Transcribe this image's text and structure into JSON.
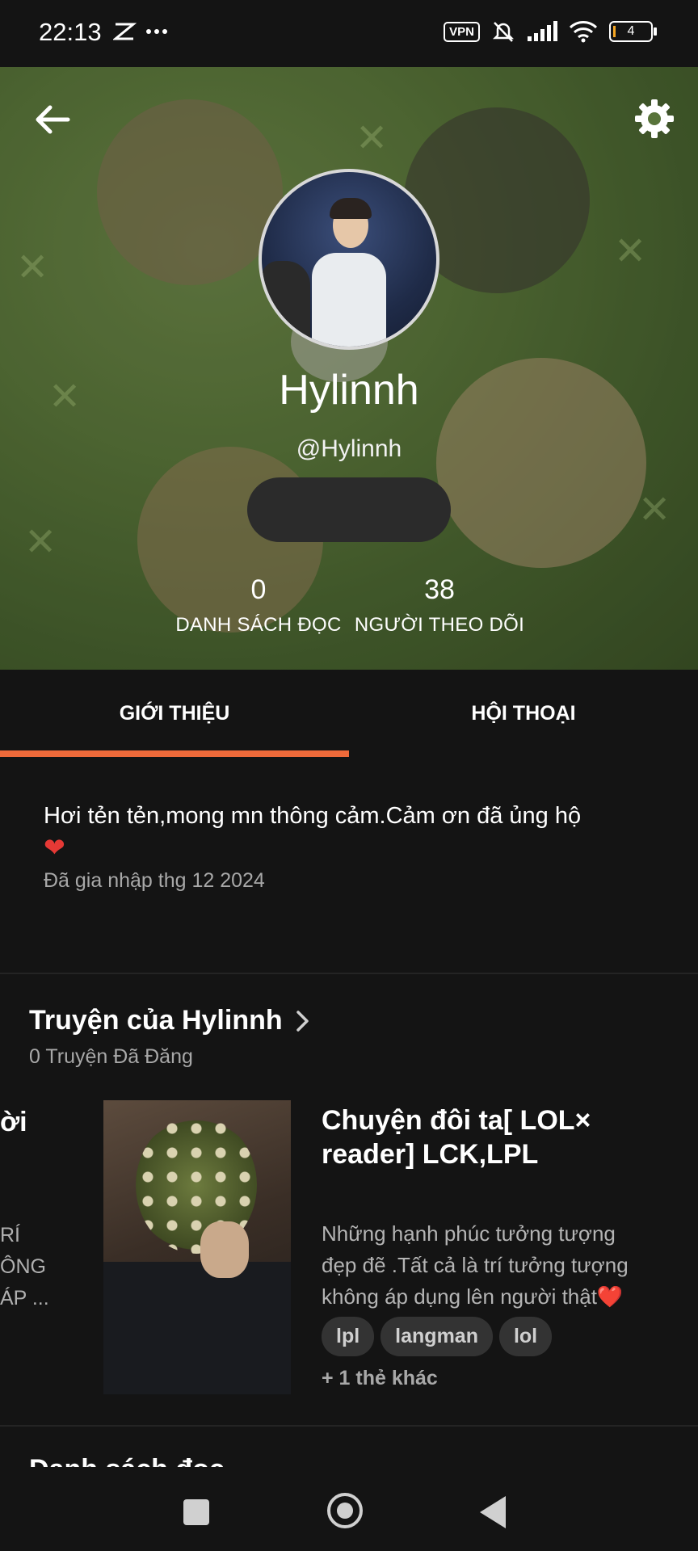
{
  "status_bar": {
    "time": "22:13",
    "icons": [
      "capcut-icon",
      "more-dots-icon"
    ],
    "vpn_label": "VPN",
    "battery_level": "4",
    "right_icons": [
      "vpn-icon",
      "bell-muted-icon",
      "signal-icon",
      "wifi-icon",
      "battery-icon"
    ]
  },
  "profile": {
    "display_name": "Hylinnh",
    "username": "@Hylinnh",
    "stats": {
      "reading_lists_count": "0",
      "reading_lists_label": "DANH SÁCH ĐỌC",
      "followers_count": "38",
      "followers_label": "NGƯỜI THEO DÕI"
    }
  },
  "tabs": [
    {
      "label": "GIỚI THIỆU",
      "active": true
    },
    {
      "label": "HỘI THOẠI",
      "active": false
    }
  ],
  "about": {
    "bio": "Hơi tẻn tẻn,mong mn thông cảm.Cảm ơn đã ủng hộ",
    "bio_emoji": "❤",
    "joined": "Đã gia nhập thg 12 2024"
  },
  "stories": {
    "title": "Truyện của Hylinnh",
    "count_label": "0 Truyện Đã Đăng",
    "prev_card": {
      "title_fragment": "ời",
      "desc_lines": [
        "RÍ",
        "ÔNG",
        "ÁP ..."
      ]
    },
    "items": [
      {
        "title": "Chuyện đôi ta[ LOL× reader] LCK,LPL",
        "description": "Những hạnh phúc tưởng tượng đẹp đẽ .Tất cả là trí tưởng tượng không áp dụng lên người thật❤️",
        "tags": [
          "lpl",
          "langman",
          "lol"
        ],
        "more_tags": "+ 1 thẻ khác"
      }
    ],
    "next_section_partial": "Danh sách đọc"
  },
  "colors": {
    "accent": "#ee6a3a",
    "background": "#141414",
    "header_green": "#5d7a3c"
  }
}
